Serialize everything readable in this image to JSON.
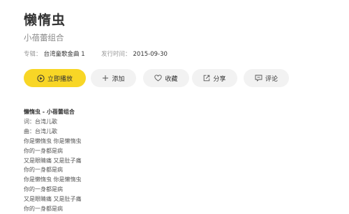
{
  "song": {
    "title": "懒惰虫",
    "artist": "小蓓蕾组合",
    "album_label": "专辑：",
    "album_name": "台湾童歌金曲 1",
    "date_label": "发行时间：",
    "date_value": "2015-09-30"
  },
  "actions": {
    "play_label": "立即播放",
    "add_label": "添加",
    "favorite_label": "收藏",
    "share_label": "分享",
    "comment_label": "评论"
  },
  "lyrics": {
    "header": "懒惰虫 - 小蓓蕾组合",
    "lines": [
      "词：台湾儿歌",
      "曲：台湾儿歌",
      "你是懒惰虫 你是懒惰虫",
      "你的一身都是病",
      "又是眼睛痛 又是肚子痛",
      "你的一身都是病",
      "你是懒惰虫 你是懒惰虫",
      "你的一身都是病",
      "又是眼睛痛 又是肚子痛",
      "你的一身都是病"
    ]
  },
  "colors": {
    "accent": "#f8d626",
    "button_bg": "#f2f2f2",
    "text_primary": "#333333",
    "text_secondary": "#999999"
  }
}
